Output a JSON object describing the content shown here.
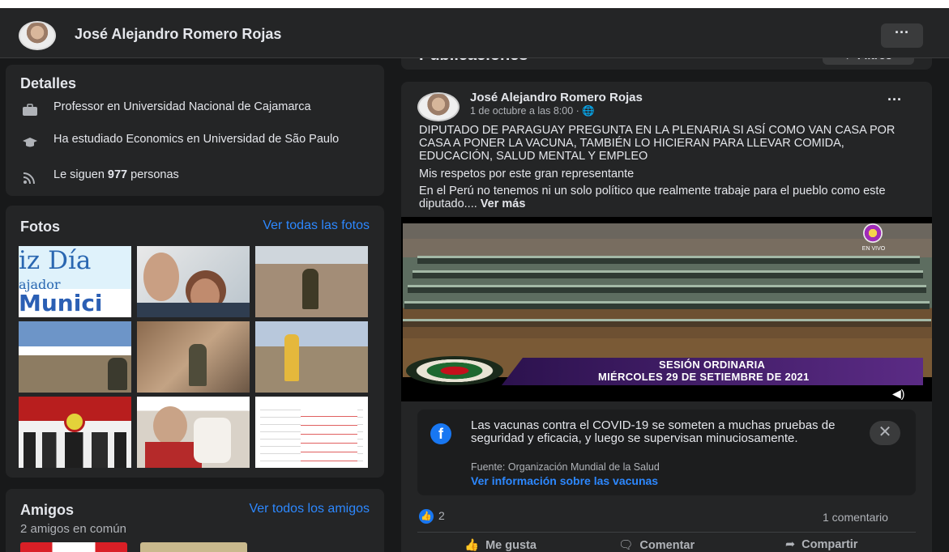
{
  "profile": {
    "name": "José Alejandro Romero Rojas",
    "more_label": "···"
  },
  "details": {
    "title": "Detalles",
    "items": [
      {
        "icon": "briefcase-icon",
        "text": "Professor en Universidad Nacional de Cajamarca"
      },
      {
        "icon": "graduation-cap-icon",
        "text": "Ha estudiado Economics en Universidad de São Paulo"
      },
      {
        "icon": "rss-icon",
        "prefix": "Le siguen ",
        "count": "977",
        "suffix": " personas"
      }
    ]
  },
  "photos": {
    "title": "Fotos",
    "see_all": "Ver todas las fotos",
    "first_photo_text": [
      "iz Día",
      "ajador",
      "Munici"
    ]
  },
  "friends": {
    "title": "Amigos",
    "see_all": "Ver todos los amigos",
    "common": "2 amigos en común"
  },
  "publications": {
    "title": "Publicaciones",
    "filters_label": "Filtros"
  },
  "post": {
    "author": "José Alejandro Romero Rojas",
    "date": "1 de octubre a las 8:00 · 🌐",
    "menu": "···",
    "paragraph1": "DIPUTADO DE PARAGUAY PREGUNTA EN LA PLENARIA SI ASÍ COMO VAN CASA POR CASA A PONER LA VACUNA, TAMBIÉN LO HICIERAN PARA LLEVAR COMIDA, EDUCACIÓN, SALUD MENTAL Y EMPLEO",
    "paragraph2": "Mis respetos por este gran representante",
    "paragraph3": "En el Perú no tenemos ni un solo político que realmente trabaje para el pueblo como este diputado.... ",
    "see_more": "Ver más",
    "video": {
      "caption_line1": "SESIÓN ORDINARIA",
      "caption_line2": "MIÉRCOLES 29 DE SETIEMBRE DE 2021",
      "live_label": "EN VIVO"
    },
    "covid_info": {
      "message": "Las vacunas contra el COVID-19 se someten a muchas pruebas de seguridad y eficacia, y luego se supervisan minuciosamente.",
      "source": "Fuente: Organización Mundial de la Salud",
      "link": "Ver información sobre las vacunas",
      "close": "✕"
    },
    "reactions_count": "2",
    "comments_count": "1 comentario",
    "actions": {
      "like": "Me gusta",
      "comment": "Comentar",
      "share": "Compartir"
    }
  },
  "colors": {
    "background": "#18191a",
    "card": "#242526",
    "accent": "#2d88ff",
    "facebook_blue": "#1877f2"
  }
}
